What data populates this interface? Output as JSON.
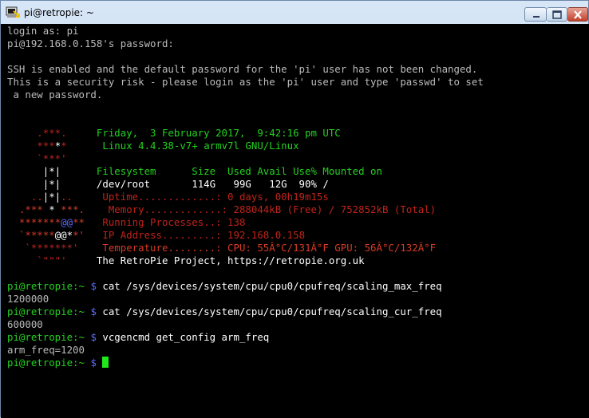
{
  "window": {
    "title": "pi@retropie: ~",
    "buttons": {
      "minimize": "minimize",
      "maximize": "maximize",
      "close": "close"
    }
  },
  "colors": {
    "text": "#bbbbbb",
    "green": "#23d11f",
    "red": "#c0231a",
    "bright_red": "#d83a24",
    "white": "#ffffff",
    "blue": "#5b6cff",
    "cursor": "#21e81b",
    "background": "#000000"
  },
  "terminal": {
    "lines": [
      [
        {
          "t": "login as: pi",
          "c": "gray"
        }
      ],
      [
        {
          "t": "pi@192.168.0.158's password:",
          "c": "gray"
        }
      ],
      [
        {
          "t": "",
          "c": "gray"
        }
      ],
      [
        {
          "t": "SSH is enabled and the default password for the 'pi' user has not been changed.",
          "c": "gray"
        }
      ],
      [
        {
          "t": "This is a security risk - please login as the 'pi' user and type 'passwd' to set",
          "c": "gray"
        }
      ],
      [
        {
          "t": " a new password.",
          "c": "gray"
        }
      ],
      [
        {
          "t": "",
          "c": "gray"
        }
      ],
      [
        {
          "t": "",
          "c": "gray"
        }
      ],
      [
        {
          "t": "     .***.     ",
          "c": "darkred"
        },
        {
          "t": "Friday,  3 February 2017,  9:42:16 pm UTC",
          "c": "green"
        }
      ],
      [
        {
          "t": "     ***",
          "c": "darkred"
        },
        {
          "t": "*",
          "c": "white"
        },
        {
          "t": "*      ",
          "c": "darkred"
        },
        {
          "t": "Linux 4.4.38-v7+ armv7l GNU/Linux",
          "c": "green"
        }
      ],
      [
        {
          "t": "     `***'",
          "c": "darkred"
        }
      ],
      [
        {
          "t": "      |*|      ",
          "c": "white"
        },
        {
          "t": "Filesystem      Size  Used Avail Use% Mounted on",
          "c": "green"
        }
      ],
      [
        {
          "t": "      |*|      ",
          "c": "white"
        },
        {
          "t": "/dev/root       114G   99G   12G  90% /",
          "c": "white"
        }
      ],
      [
        {
          "t": "    ..",
          "c": "darkred"
        },
        {
          "t": "|*|",
          "c": "white"
        },
        {
          "t": "..     ",
          "c": "darkred"
        },
        {
          "t": "Uptime.............: 0 days, 00h19m15s",
          "c": "darkred"
        }
      ],
      [
        {
          "t": "  .*** ",
          "c": "red"
        },
        {
          "t": "*",
          "c": "white"
        },
        {
          "t": " ***.    ",
          "c": "red"
        },
        {
          "t": "Memory.............: 288044kB (Free) / 752852kB (Total)",
          "c": "darkred"
        }
      ],
      [
        {
          "t": "  *******",
          "c": "red"
        },
        {
          "t": "@@",
          "c": "blue"
        },
        {
          "t": "**   ",
          "c": "red"
        },
        {
          "t": "Running Processes..: 138",
          "c": "darkred"
        }
      ],
      [
        {
          "t": "  `*****",
          "c": "red"
        },
        {
          "t": "@@",
          "c": "white"
        },
        {
          "t": "*",
          "c": "white"
        },
        {
          "t": "*'   ",
          "c": "red"
        },
        {
          "t": "IP Address.........: 192.168.0.158",
          "c": "darkred"
        }
      ],
      [
        {
          "t": "   `*******'    ",
          "c": "darkred"
        },
        {
          "t": "Temperature........: CPU: 55Â°C/131Â°F GPU: 56Â°C/132Â°F",
          "c": "red"
        }
      ],
      [
        {
          "t": "     `\"\"\"'     ",
          "c": "darkred"
        },
        {
          "t": "The RetroPie Project, https://retropie.org.uk",
          "c": "white"
        }
      ],
      [
        {
          "t": "",
          "c": "gray"
        }
      ],
      [
        {
          "t": "pi@retropie:~ ",
          "c": "green"
        },
        {
          "t": "$ ",
          "c": "blue"
        },
        {
          "t": "cat /sys/devices/system/cpu/cpu0/cpufreq/scaling_max_freq",
          "c": "white"
        }
      ],
      [
        {
          "t": "1200000",
          "c": "gray"
        }
      ],
      [
        {
          "t": "pi@retropie:~ ",
          "c": "green"
        },
        {
          "t": "$ ",
          "c": "blue"
        },
        {
          "t": "cat /sys/devices/system/cpu/cpu0/cpufreq/scaling_cur_freq",
          "c": "white"
        }
      ],
      [
        {
          "t": "600000",
          "c": "gray"
        }
      ],
      [
        {
          "t": "pi@retropie:~ ",
          "c": "green"
        },
        {
          "t": "$ ",
          "c": "blue"
        },
        {
          "t": "vcgencmd get_config arm_freq",
          "c": "white"
        }
      ],
      [
        {
          "t": "arm_freq=1200",
          "c": "gray"
        }
      ],
      [
        {
          "t": "pi@retropie:~ ",
          "c": "green"
        },
        {
          "t": "$ ",
          "c": "blue"
        }
      ]
    ]
  }
}
